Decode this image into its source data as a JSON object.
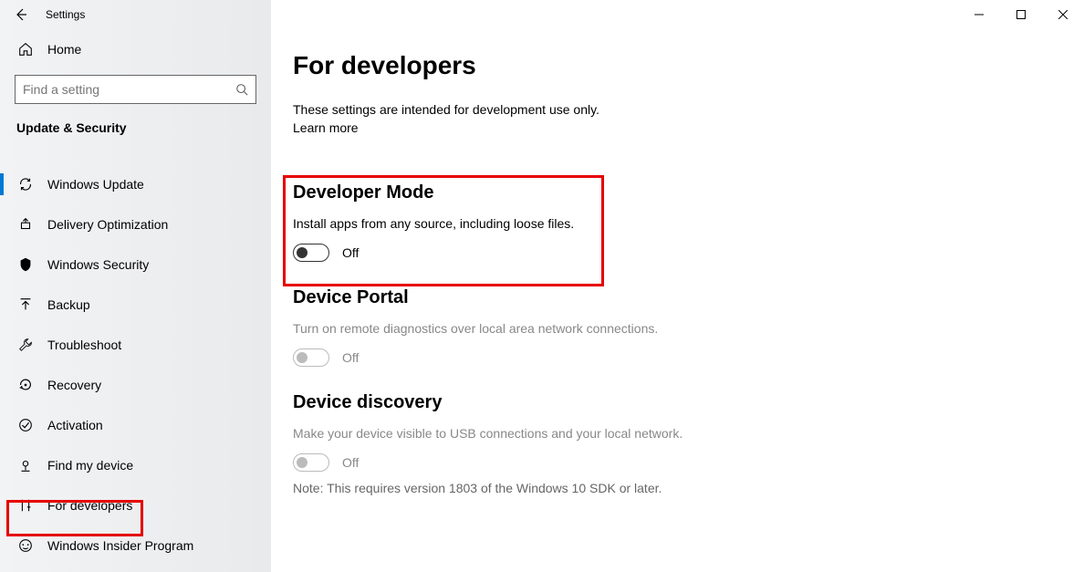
{
  "window": {
    "title": "Settings"
  },
  "sidebar": {
    "homeLabel": "Home",
    "searchPlaceholder": "Find a setting",
    "sectionLabel": "Update & Security",
    "items": [
      {
        "label": "Windows Update"
      },
      {
        "label": "Delivery Optimization"
      },
      {
        "label": "Windows Security"
      },
      {
        "label": "Backup"
      },
      {
        "label": "Troubleshoot"
      },
      {
        "label": "Recovery"
      },
      {
        "label": "Activation"
      },
      {
        "label": "Find my device"
      },
      {
        "label": "For developers"
      },
      {
        "label": "Windows Insider Program"
      }
    ]
  },
  "main": {
    "title": "For developers",
    "intro": "These settings are intended for development use only.",
    "learnMore": "Learn more",
    "sections": {
      "devmode": {
        "title": "Developer Mode",
        "desc": "Install apps from any source, including loose files.",
        "toggleState": "Off"
      },
      "portal": {
        "title": "Device Portal",
        "desc": "Turn on remote diagnostics over local area network connections.",
        "toggleState": "Off"
      },
      "discovery": {
        "title": "Device discovery",
        "desc": "Make your device visible to USB connections and your local network.",
        "toggleState": "Off",
        "note": "Note: This requires version 1803 of the Windows 10 SDK or later."
      }
    }
  }
}
